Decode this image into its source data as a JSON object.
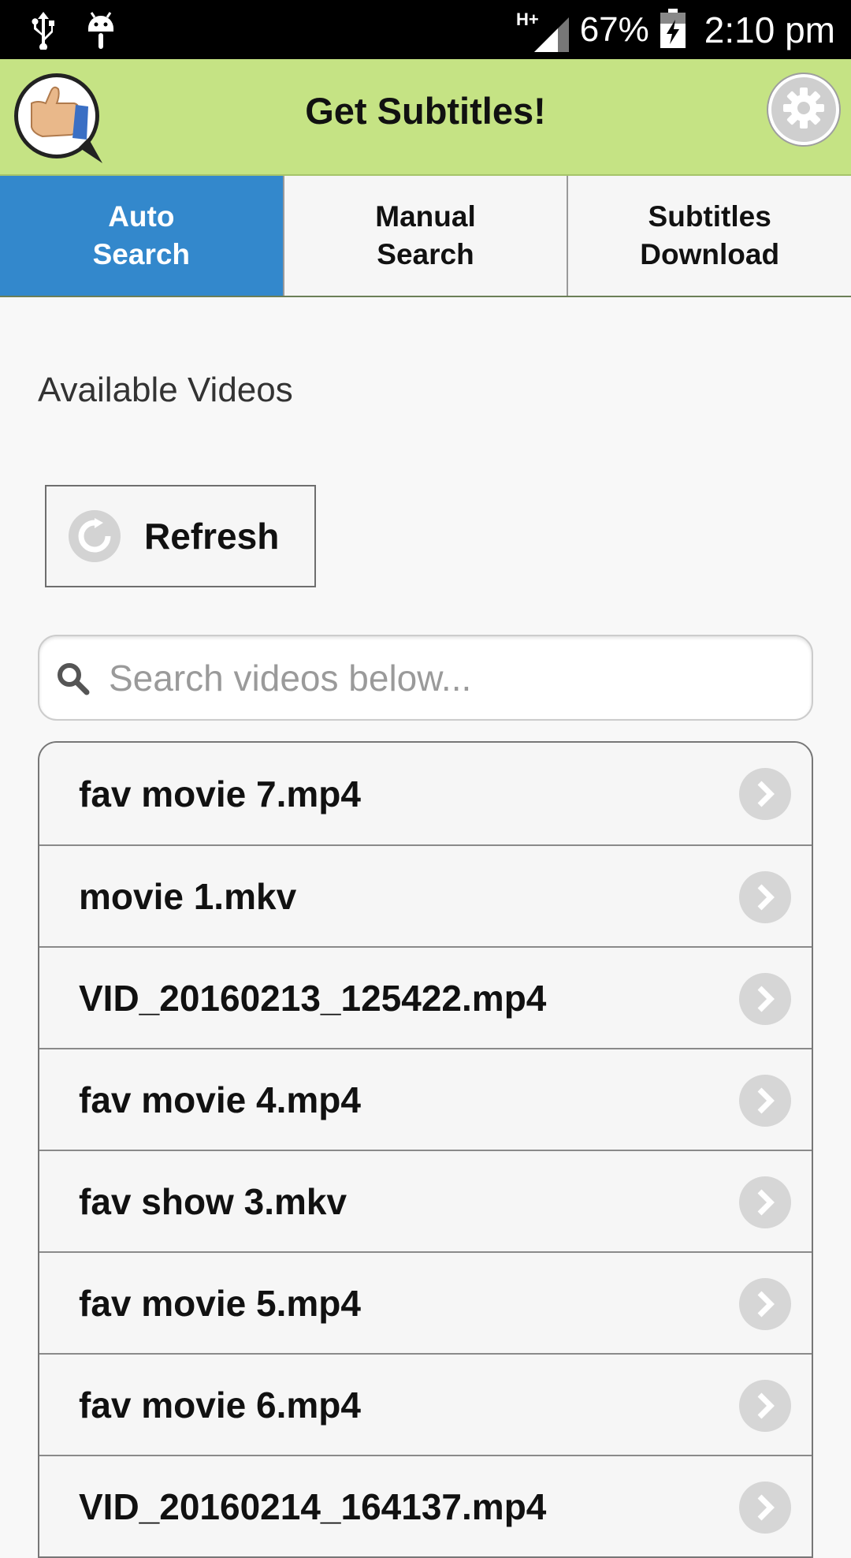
{
  "status_bar": {
    "network": "H+",
    "battery_percent": "67%",
    "time": "2:10 pm"
  },
  "header": {
    "title": "Get Subtitles!"
  },
  "tabs": [
    {
      "line1": "Auto",
      "line2": "Search",
      "active": true
    },
    {
      "line1": "Manual",
      "line2": "Search",
      "active": false
    },
    {
      "line1": "Subtitles",
      "line2": "Download",
      "active": false
    }
  ],
  "main": {
    "section_title": "Available Videos",
    "refresh_label": "Refresh",
    "search": {
      "placeholder": "Search videos below...",
      "value": ""
    },
    "videos": [
      "fav movie 7.mp4",
      "movie 1.mkv",
      "VID_20160213_125422.mp4",
      "fav movie 4.mp4",
      "fav show 3.mkv",
      "fav movie 5.mp4",
      "fav movie 6.mp4",
      "VID_20160214_164137.mp4"
    ]
  },
  "colors": {
    "header_bg": "#c5e384",
    "active_tab": "#3388cc"
  }
}
